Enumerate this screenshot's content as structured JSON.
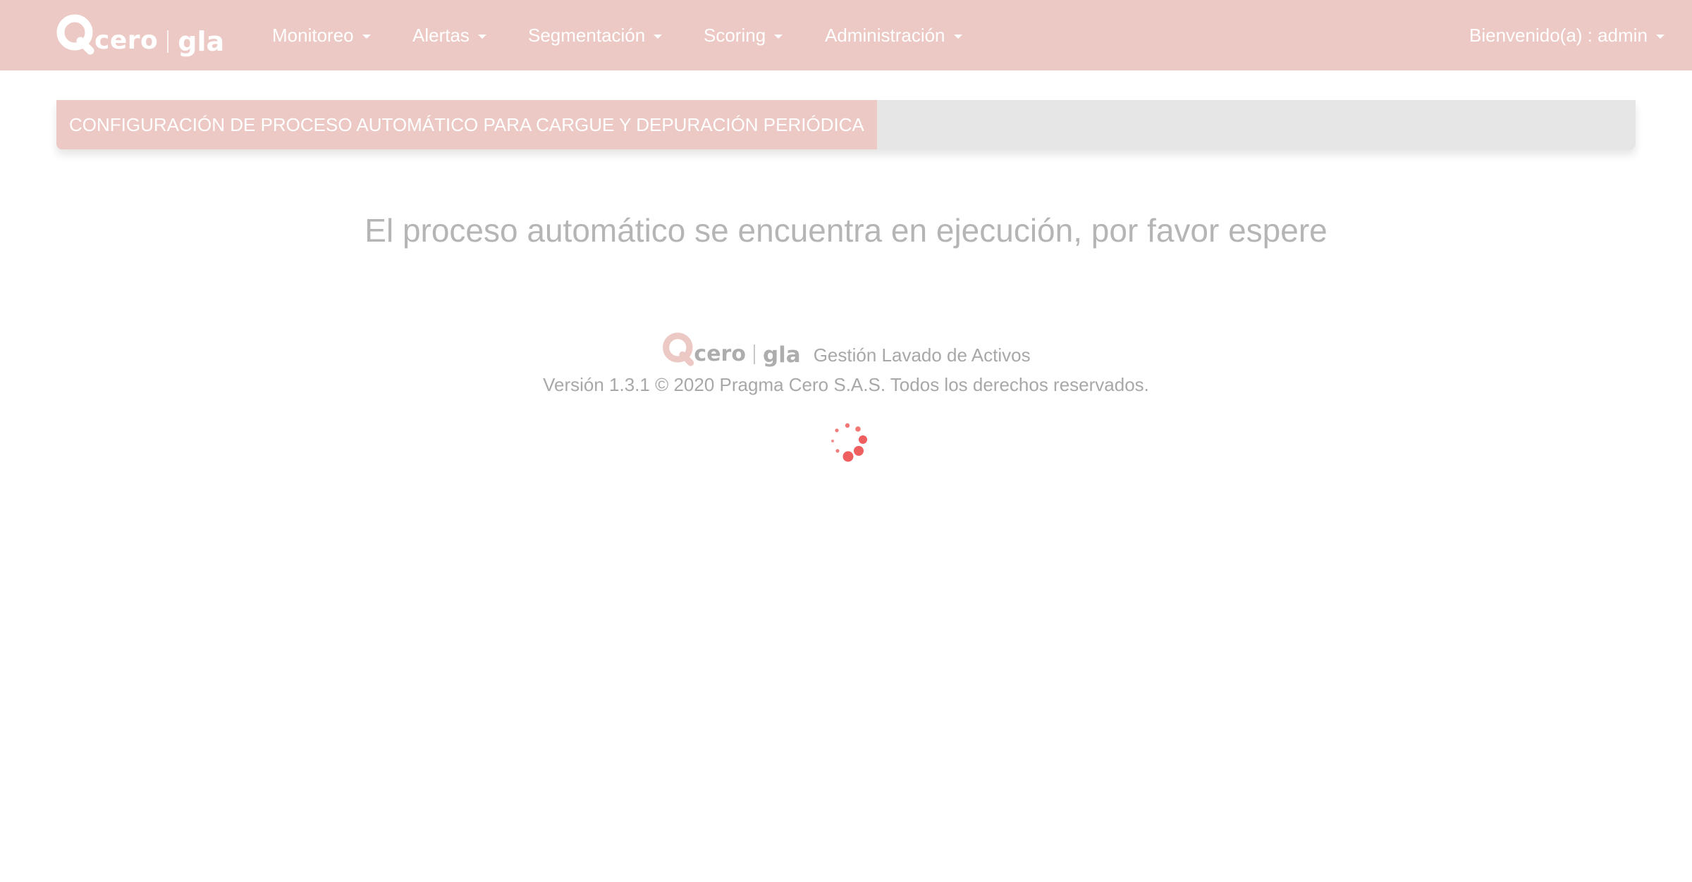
{
  "navbar": {
    "logo": {
      "text": "cero",
      "sub": "gla"
    },
    "menus": [
      {
        "label": "Monitoreo"
      },
      {
        "label": "Alertas"
      },
      {
        "label": "Segmentación"
      },
      {
        "label": "Scoring"
      },
      {
        "label": "Administración"
      }
    ],
    "user": {
      "label": "Bienvenido(a) : admin"
    }
  },
  "panel": {
    "title": "CONFIGURACIÓN DE PROCESO AUTOMÁTICO PARA CARGUE Y DEPURACIÓN PERIÓDICA"
  },
  "status": {
    "message": "El proceso automático se encuentra en ejecución, por favor espere"
  },
  "footer": {
    "logo": {
      "text": "cero",
      "sub": "gla"
    },
    "tagline": "Gestión Lavado de Activos",
    "version": "Versión 1.3.1 © 2020 Pragma Cero S.A.S. Todos los derechos reservados."
  },
  "colors": {
    "navbar": "#ecc9c4",
    "panel_bg": "#e6e6e6",
    "spinner": "#ef5f5f",
    "muted_text": "#a8a8a8"
  },
  "icons": {
    "logo_mark": "logo-mark-icon",
    "caret": "caret-down-icon",
    "spinner": "loading-spinner-icon"
  }
}
